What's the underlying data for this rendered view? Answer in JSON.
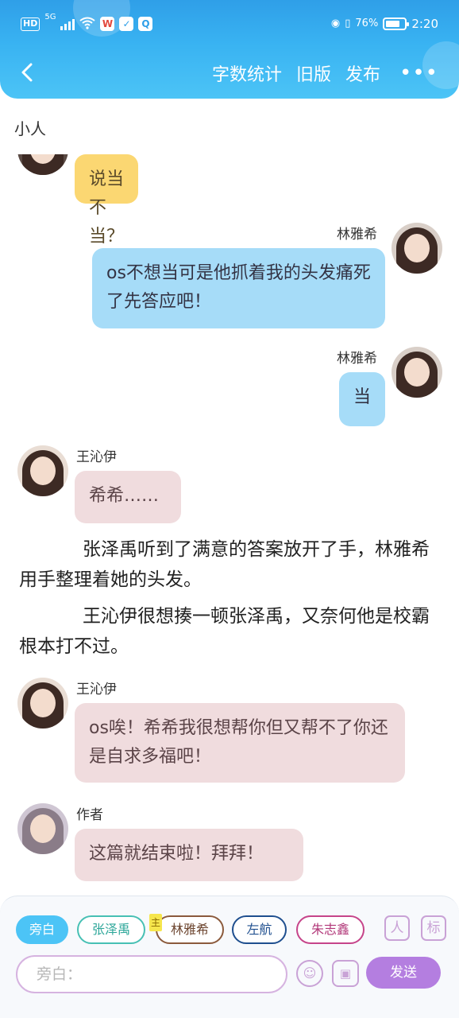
{
  "status_bar": {
    "hd": "HD",
    "network": "5G",
    "app_icons": [
      "weibo-icon",
      "shield-icon",
      "baidu-icon"
    ],
    "battery_text": "76%",
    "battery_level": 0.76,
    "time": "2:20"
  },
  "header": {
    "back_icon": "chevron-left-icon",
    "actions": [
      "字数统计",
      "旧版",
      "发布"
    ],
    "more_icon": "more-dots-icon"
  },
  "section_title": "小人",
  "messages": [
    {
      "side": "left",
      "name": "",
      "text": "说当不当？",
      "color": "yellow"
    },
    {
      "side": "right",
      "name": "林雅希",
      "text": "os不想当可是他抓着我的头发痛死了先答应吧！",
      "color": "blue"
    },
    {
      "side": "right",
      "name": "林雅希",
      "text": "当",
      "color": "blue"
    },
    {
      "side": "left",
      "name": "王沁伊",
      "text": "希希……",
      "color": "pink"
    },
    {
      "type": "narration",
      "text": "张泽禹听到了满意的答案放开了手，林雅希用手整理着她的头发。"
    },
    {
      "type": "narration",
      "text": "王沁伊很想揍一顿张泽禹，又奈何他是校霸根本打不过。"
    },
    {
      "side": "left",
      "name": "王沁伊",
      "text": "os唉！希希我很想帮你但又帮不了你还是自求多福吧！",
      "color": "pink"
    },
    {
      "side": "left",
      "name": "作者",
      "text": "这篇就结束啦！拜拜！",
      "color": "pink"
    }
  ],
  "composer": {
    "chips": [
      "旁白",
      "张泽禹",
      "林雅希",
      "左航",
      "朱志鑫"
    ],
    "lead_tag": "主",
    "side_icons": [
      "user-card-icon",
      "tag-icon"
    ],
    "side_icon_glyphs": [
      "人",
      "标"
    ],
    "input_placeholder": "旁白：",
    "send_label": "发送",
    "emoji_icon": "smile-icon",
    "image_icon": "image-icon"
  },
  "colors": {
    "header_blue": "#39b3f2",
    "bubble_yellow": "#fbd772",
    "bubble_blue": "#a6dcf8",
    "bubble_pink": "#f0dcde",
    "send_purple": "#b47ee0"
  }
}
